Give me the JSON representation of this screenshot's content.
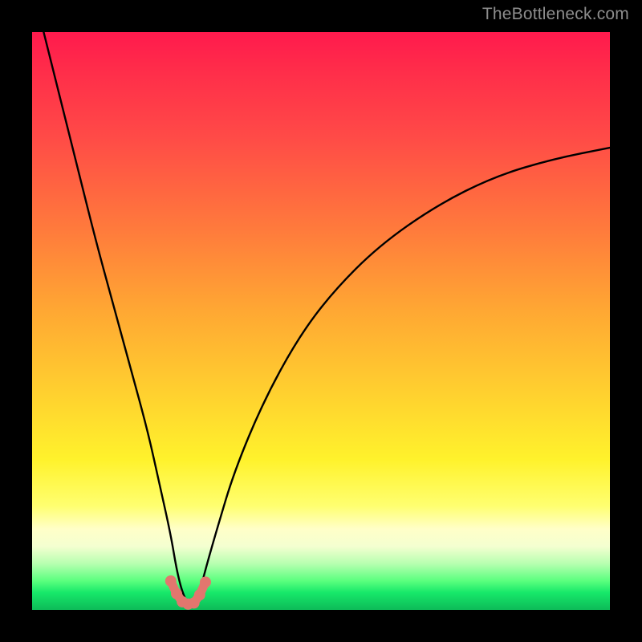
{
  "watermark": "TheBottleneck.com",
  "chart_data": {
    "type": "line",
    "title": "",
    "xlabel": "",
    "ylabel": "",
    "xlim": [
      0,
      100
    ],
    "ylim": [
      0,
      100
    ],
    "grid": false,
    "legend": "none",
    "note": "Single V-shaped bottleneck curve over a red→green vertical gradient. Minimum (optimal) point sits near x≈27 at the bottom. Curve rises steeply to the left toward 100 and more gradually to the right toward ~80. A short salmon-colored segment of connected dots marks the trough.",
    "series": [
      {
        "name": "bottleneck-curve",
        "color": "#000000",
        "x": [
          2,
          5,
          8,
          11,
          14,
          17,
          20,
          22,
          24,
          25,
          26,
          27,
          28,
          29,
          30,
          32,
          35,
          40,
          46,
          52,
          60,
          70,
          80,
          90,
          100
        ],
        "values": [
          100,
          88,
          76,
          64,
          53,
          42,
          31,
          22,
          13,
          7,
          3,
          1,
          1,
          3,
          7,
          14,
          24,
          36,
          47,
          55,
          63,
          70,
          75,
          78,
          80
        ]
      },
      {
        "name": "optimal-markers",
        "color": "#e2766e",
        "x": [
          24,
          25,
          26,
          27,
          28,
          29,
          30
        ],
        "values": [
          5.0,
          2.8,
          1.4,
          1.0,
          1.2,
          2.6,
          4.8
        ]
      }
    ]
  }
}
